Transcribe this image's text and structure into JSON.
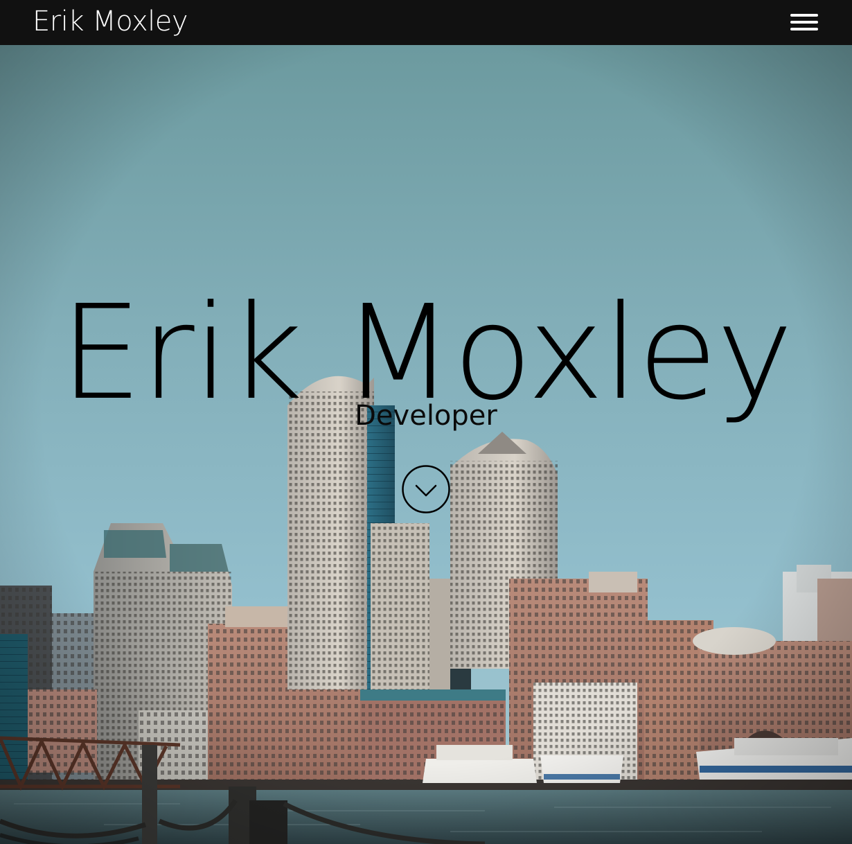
{
  "navbar": {
    "brand": "Erik Moxley",
    "menu_icon": "hamburger-menu-icon"
  },
  "hero": {
    "title": "Erik Moxley",
    "subtitle": "Developer",
    "scroll_icon": "chevron-down-circle-icon",
    "background": "harbor-city-skyline-photo"
  },
  "colors": {
    "navbar_bg": "#111111",
    "nav_text": "#ffffff",
    "hero_text": "#000000",
    "sky_top": "#6b9aa0",
    "sky_mid": "#8fb9c6",
    "water": "#3f5a60"
  }
}
